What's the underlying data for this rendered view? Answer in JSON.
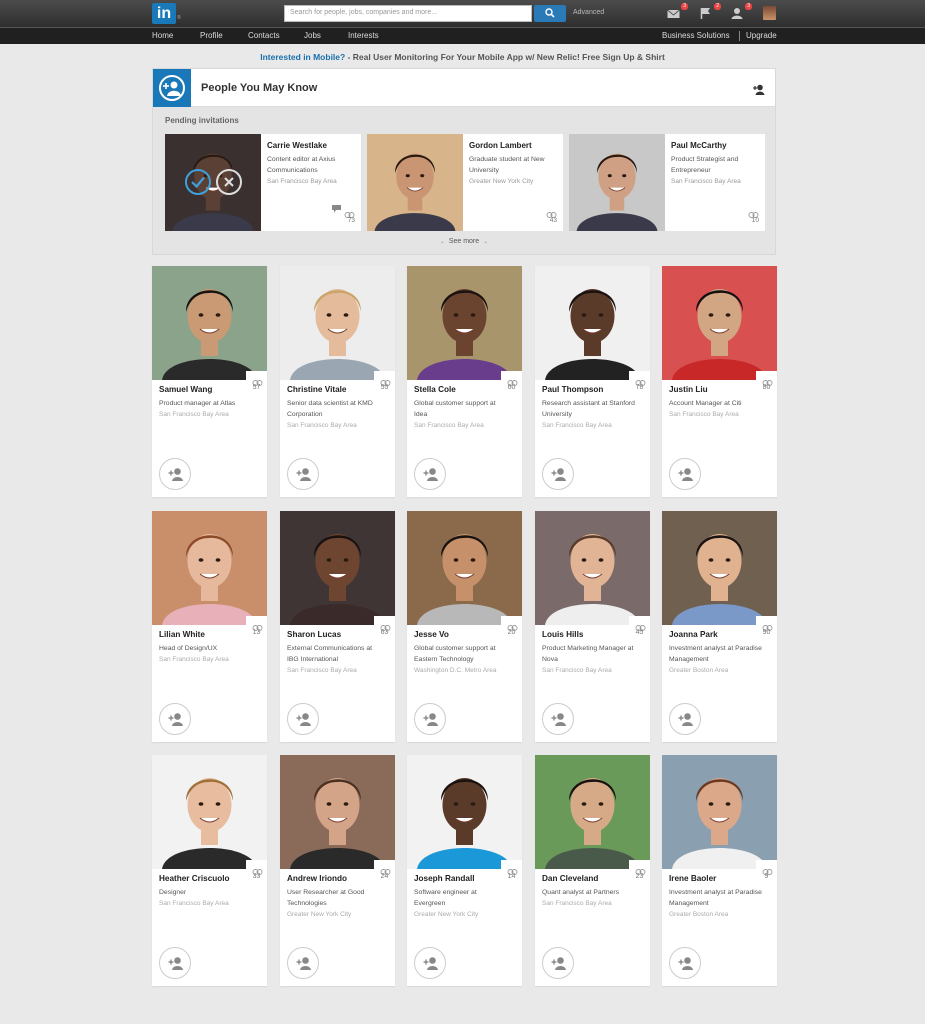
{
  "topbar": {
    "logo": "in",
    "logo_mark": "®",
    "search_placeholder": "Search for people, jobs, companies and more...",
    "advanced": "Advanced",
    "badges": {
      "messages": "3",
      "notifications": "2",
      "invitations": "3"
    }
  },
  "nav": {
    "items": [
      "Home",
      "Profile",
      "Contacts",
      "Jobs",
      "Interests"
    ],
    "right": [
      "Business Solutions",
      "Upgrade"
    ]
  },
  "promo": {
    "link": "Interested in Mobile?",
    "text": " - Real User Monitoring For Your Mobile App w/ New Relic! Free Sign Up & Shirt"
  },
  "pymk": {
    "title": "People You May Know",
    "pending_label": "Pending invitations",
    "see_more": "See more",
    "pending": [
      {
        "name": "Carrie Westlake",
        "title": "Content editor at Axius Communications",
        "location": "San Francisco Bay Area",
        "count": "73",
        "skin": "#5b4036",
        "bg": "#3a3030"
      },
      {
        "name": "Gordon Lambert",
        "title": "Graduate student at New University",
        "location": "Greater New York City",
        "count": "43",
        "skin": "#c99572",
        "bg": "#d8b48a"
      },
      {
        "name": "Paul McCarthy",
        "title": "Product Strategist and Entrepreneur",
        "location": "San Francisco Bay Area",
        "count": "10",
        "skin": "#d0a084",
        "bg": "#c8c8c8"
      }
    ]
  },
  "people": [
    {
      "name": "Samuel Wang",
      "title": "Product manager at Atlas",
      "location": "San Francisco Bay Area",
      "count": "57",
      "skin": "#c99a74",
      "bg": "#8aa38a",
      "hair": "#1a1410",
      "shirt": "#2a2a2a"
    },
    {
      "name": "Christine Vitale",
      "title": "Senior data scientist at KMD Corporation",
      "location": "San Francisco Bay Area",
      "count": "55",
      "skin": "#e4bb9b",
      "bg": "#ededed",
      "hair": "#c9a56a",
      "shirt": "#9aa7b2"
    },
    {
      "name": "Stella Cole",
      "title": "Global customer support at Idea",
      "location": "San Francisco Bay Area",
      "count": "60",
      "skin": "#6b4430",
      "bg": "#a8956c",
      "hair": "#1a1210",
      "shirt": "#6a3d8c"
    },
    {
      "name": "Paul Thompson",
      "title": "Research assistant at Stanford University",
      "location": "San Francisco Bay Area",
      "count": "78",
      "skin": "#5a3a28",
      "bg": "#f0f0f0",
      "hair": "#1a1210",
      "shirt": "#222222"
    },
    {
      "name": "Justin Liu",
      "title": "Account Manager at Citi",
      "location": "San Francisco Bay Area",
      "count": "80",
      "skin": "#d2a682",
      "bg": "#d85050",
      "hair": "#151010",
      "shirt": "#c82828"
    },
    {
      "name": "Lilian White",
      "title": "Head of Design/UX",
      "location": "San Francisco Bay Area",
      "count": "13",
      "skin": "#e6b89c",
      "bg": "#c88f6a",
      "hair": "#8a4a2a",
      "shirt": "#e8b0b8"
    },
    {
      "name": "Sharon Lucas",
      "title": "External Communications at IBG International",
      "location": "San Francisco Bay Area",
      "count": "63",
      "skin": "#6e4530",
      "bg": "#403535",
      "hair": "#1a1210",
      "shirt": "#3a2a2a"
    },
    {
      "name": "Jesse Vo",
      "title": "Global customer support at Eastern Technology",
      "location": "Washington D.C. Metro Area",
      "count": "20",
      "skin": "#c6916a",
      "bg": "#8a6a4a",
      "hair": "#1a1210",
      "shirt": "#b8b8b8"
    },
    {
      "name": "Louis Hills",
      "title": "Product Marketing Manager at Nova",
      "location": "San Francisco Bay Area",
      "count": "45",
      "skin": "#e2b496",
      "bg": "#7a6a6a",
      "hair": "#5a3a28",
      "shirt": "#eeeeee"
    },
    {
      "name": "Joanna Park",
      "title": "Investment analyst at Paradise Management",
      "location": "Greater Boston Area",
      "count": "90",
      "skin": "#e0b290",
      "bg": "#706050",
      "hair": "#1a1210",
      "shirt": "#7a98c8"
    },
    {
      "name": "Heather Criscuolo",
      "title": "Designer",
      "location": "San Francisco Bay Area",
      "count": "33",
      "skin": "#e8bc9e",
      "bg": "#f2f2f2",
      "hair": "#a0703a",
      "shirt": "#2a2a2a"
    },
    {
      "name": "Andrew Iriondo",
      "title": "User Researcher at Good Technologies",
      "location": "Greater New York City",
      "count": "24",
      "skin": "#d4a488",
      "bg": "#8a6a58",
      "hair": "#4a3020",
      "shirt": "#2a2a2a"
    },
    {
      "name": "Joseph Randall",
      "title": "Software engineer at Evergreen",
      "location": "Greater New York City",
      "count": "14",
      "skin": "#5a3a28",
      "bg": "#f2f2f2",
      "hair": "#1a1210",
      "shirt": "#1a98d8"
    },
    {
      "name": "Dan Cleveland",
      "title": "Quant analyst at Partners",
      "location": "San Francisco Bay Area",
      "count": "23",
      "skin": "#d6aa86",
      "bg": "#6a9a5a",
      "hair": "#1a1210",
      "shirt": "#4a5a4a"
    },
    {
      "name": "Irene Baoler",
      "title": "Investment analyst at Paradise Management",
      "location": "Greater Boston Area",
      "count": "9",
      "skin": "#dca88a",
      "bg": "#8aa0b0",
      "hair": "#6a3a20",
      "shirt": "#f0f0f0"
    }
  ]
}
